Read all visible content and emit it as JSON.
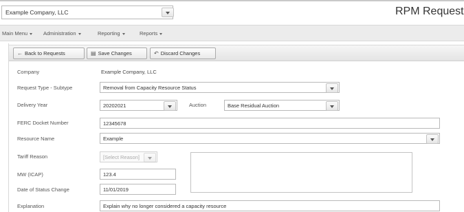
{
  "header": {
    "company_value": "Example Company, LLC",
    "app_title": "RPM Request"
  },
  "menu": {
    "items": [
      {
        "label": "Main Menu"
      },
      {
        "label": "Administration"
      },
      {
        "label": "Reporting"
      },
      {
        "label": "Reports"
      }
    ]
  },
  "toolbar": {
    "back_label": "Back to Requests",
    "save_label": "Save Changes",
    "discard_label": "Discard Changes"
  },
  "form": {
    "company_label": "Company",
    "company_value": "Example Company, LLC",
    "request_type_label": "Request Type - Subtype",
    "request_type_value": "Removal from Capacity Resource Status",
    "delivery_year_label": "Delivery Year",
    "delivery_year_value": "20202021",
    "auction_label": "Auction",
    "auction_value": "Base Residual Auction",
    "ferc_label": "FERC Docket Number",
    "ferc_value": "12345678",
    "resource_name_label": "Resource Name",
    "resource_name_value": "Example",
    "tariff_reason_label": "Tariff Reason",
    "tariff_reason_placeholder": "[Select Reason]",
    "mw_label": "MW (ICAP)",
    "mw_value": "123.4",
    "date_label": "Date of Status Change",
    "date_value": "11/01/2019",
    "explanation_label": "Explanation",
    "explanation_value": "Explain why no longer considered a capacity resource"
  },
  "icons": {
    "back": "arrow-left-icon",
    "save": "save-icon",
    "discard": "undo-icon",
    "dropdown": "chevron-down-icon"
  }
}
